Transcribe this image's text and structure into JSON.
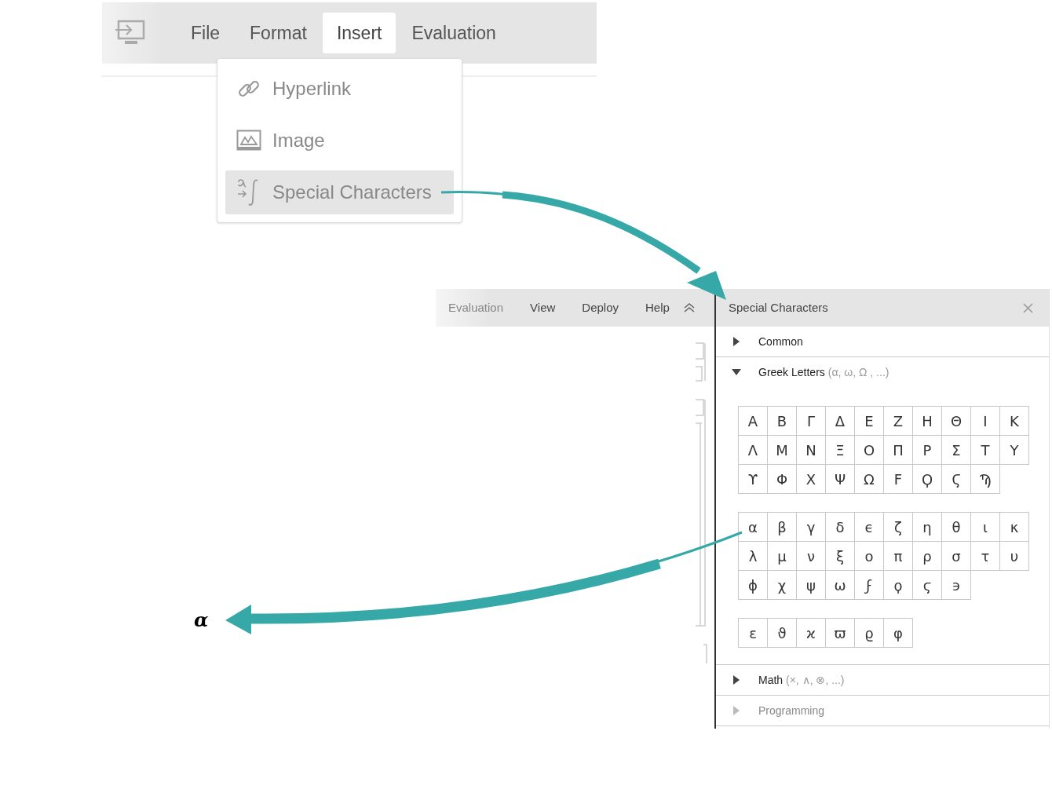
{
  "menubar": {
    "items": [
      {
        "label": "File",
        "selected": false
      },
      {
        "label": "Format",
        "selected": false
      },
      {
        "label": "Insert",
        "selected": true
      },
      {
        "label": "Evaluation",
        "selected": false
      }
    ]
  },
  "insert_menu": {
    "items": [
      {
        "kind": "link",
        "label": "Hyperlink",
        "selected": false
      },
      {
        "kind": "image",
        "label": "Image",
        "selected": false
      },
      {
        "kind": "special",
        "label": "Special Characters",
        "selected": true
      }
    ]
  },
  "toolbar": {
    "items": [
      "Evaluation",
      "View",
      "Deploy",
      "Help"
    ]
  },
  "special_characters": {
    "title": "Special Characters",
    "sections": [
      {
        "label": "Common",
        "expanded": false,
        "disabled": false
      },
      {
        "label": "Greek Letters",
        "hint": "(α, ω, Ω , ...)",
        "expanded": true,
        "disabled": false,
        "groups": [
          [
            "Α",
            "Β",
            "Γ",
            "Δ",
            "Ε",
            "Ζ",
            "Η",
            "Θ",
            "Ι",
            "Κ",
            "Λ",
            "Μ",
            "Ν",
            "Ξ",
            "Ο",
            "Π",
            "Ρ",
            "Σ",
            "Τ",
            "Υ",
            "ϒ",
            "Φ",
            "Χ",
            "Ψ",
            "Ω",
            "Ϝ",
            "Ϙ",
            "Ϛ",
            "Ϡ"
          ],
          [
            "α",
            "β",
            "γ",
            "δ",
            "ϵ",
            "ζ",
            "η",
            "θ",
            "ι",
            "κ",
            "λ",
            "μ",
            "ν",
            "ξ",
            "ο",
            "π",
            "ρ",
            "σ",
            "τ",
            "υ",
            "ϕ",
            "χ",
            "ψ",
            "ω",
            "ϝ",
            "ϙ",
            "ϛ",
            "϶"
          ],
          [
            "ε",
            "ϑ",
            "ϰ",
            "ϖ",
            "ϱ",
            "φ"
          ]
        ]
      },
      {
        "label": "Math",
        "hint": "(×, ∧, ⊗, ...)",
        "expanded": false,
        "disabled": false
      },
      {
        "label": "Programming",
        "expanded": false,
        "disabled": true
      }
    ]
  },
  "result": {
    "symbol": "α"
  }
}
